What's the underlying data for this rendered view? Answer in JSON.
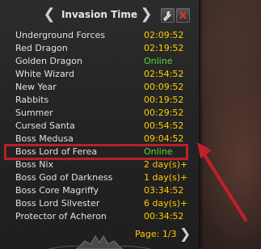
{
  "header": {
    "title": "Invasion Time"
  },
  "invasions": [
    {
      "name": "Underground Forces",
      "status": "02:09:52",
      "color": "yellow"
    },
    {
      "name": "Red Dragon",
      "status": "02:19:52",
      "color": "yellow"
    },
    {
      "name": "Golden Dragon",
      "status": "Online",
      "color": "green"
    },
    {
      "name": "White Wizard",
      "status": "02:54:52",
      "color": "yellow"
    },
    {
      "name": "New Year",
      "status": "00:09:52",
      "color": "yellow"
    },
    {
      "name": "Rabbits",
      "status": "00:19:52",
      "color": "yellow"
    },
    {
      "name": "Summer",
      "status": "00:29:52",
      "color": "yellow"
    },
    {
      "name": "Cursed Santa",
      "status": "00:54:52",
      "color": "yellow"
    },
    {
      "name": "Boss Medusa",
      "status": "09:04:52",
      "color": "yellow"
    },
    {
      "name": "Boss Lord of Ferea",
      "status": "Online",
      "color": "green"
    },
    {
      "name": "Boss Nix",
      "status": "2 day(s)+",
      "color": "yellow"
    },
    {
      "name": "Boss God of Darkness",
      "status": "1 day(s)+",
      "color": "yellow"
    },
    {
      "name": "Boss Core Magriffy",
      "status": "03:34:52",
      "color": "yellow"
    },
    {
      "name": "Boss Lord Silvester",
      "status": "6 day(s)+",
      "color": "yellow"
    },
    {
      "name": "Protector of Acheron",
      "status": "00:34:52",
      "color": "yellow"
    }
  ],
  "footer": {
    "page_label": "Page: 1/3"
  },
  "colors": {
    "yellow": "#ffcc00",
    "green": "#58d63a",
    "highlight": "#b8202a"
  }
}
